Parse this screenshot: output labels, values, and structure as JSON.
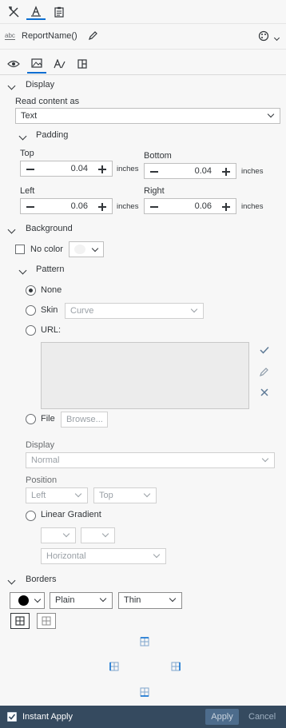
{
  "toolbar": {
    "icons": [
      "tools-icon",
      "format-brush-icon",
      "clipboard-icon"
    ],
    "accent": "#0a6ed1"
  },
  "name_bar": {
    "type_badge": "abc",
    "name": "ReportName()"
  },
  "tabs": [
    "view-icon",
    "image-icon",
    "text-format-icon",
    "layout-icon"
  ],
  "display": {
    "heading": "Display",
    "read_label": "Read content as",
    "read_value": "Text"
  },
  "padding": {
    "heading": "Padding",
    "top": {
      "label": "Top",
      "value": "0.04",
      "unit": "inches"
    },
    "bottom": {
      "label": "Bottom",
      "value": "0.04",
      "unit": "inches"
    },
    "left": {
      "label": "Left",
      "value": "0.06",
      "unit": "inches"
    },
    "right": {
      "label": "Right",
      "value": "0.06",
      "unit": "inches"
    }
  },
  "background": {
    "heading": "Background",
    "no_color_label": "No color",
    "pattern_heading": "Pattern",
    "none_label": "None",
    "skin_label": "Skin",
    "skin_value": "Curve",
    "url_label": "URL:",
    "file_label": "File",
    "browse_label": "Browse...",
    "display_label": "Display",
    "display_value": "Normal",
    "position_label": "Position",
    "pos_h": "Left",
    "pos_v": "Top",
    "gradient_label": "Linear Gradient",
    "gradient_dir": "Horizontal"
  },
  "borders": {
    "heading": "Borders",
    "style": "Plain",
    "width": "Thin"
  },
  "footer": {
    "instant_apply": "Instant Apply",
    "apply": "Apply",
    "cancel": "Cancel"
  }
}
